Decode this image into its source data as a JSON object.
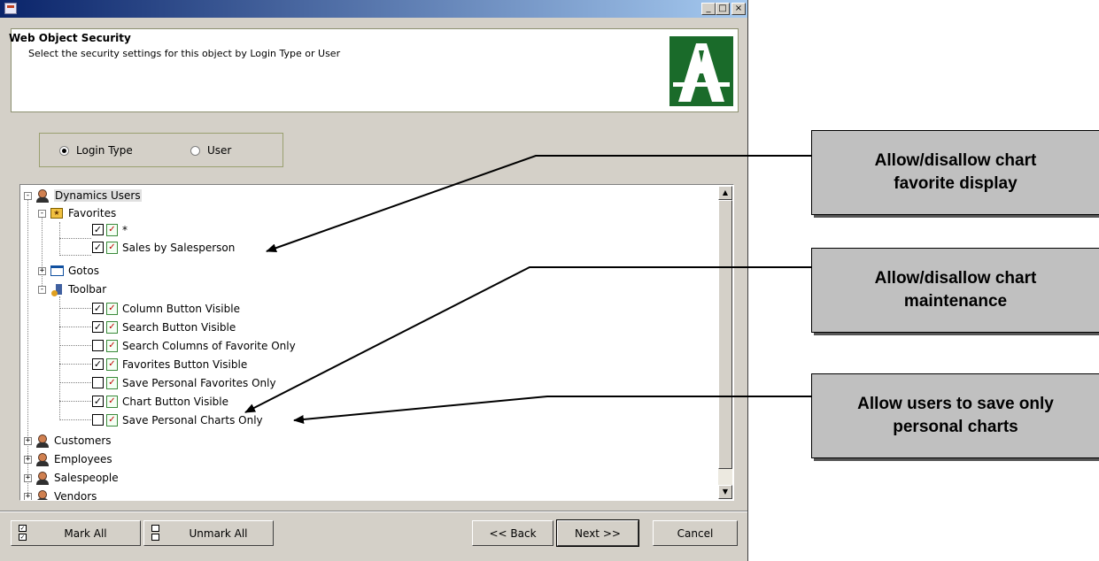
{
  "window": {
    "minimize": "_",
    "maximize": "□",
    "close": "×"
  },
  "header": {
    "title": "Web Object Security",
    "subtitle": "Select the security settings for this object by Login Type or User"
  },
  "radio": {
    "options": [
      {
        "label": "Login Type",
        "selected": true
      },
      {
        "label": "User",
        "selected": false
      }
    ]
  },
  "tree": {
    "root": "Dynamics Users",
    "favorites": {
      "label": "Favorites",
      "items": [
        {
          "label": "*",
          "checked": true
        },
        {
          "label": "Sales by Salesperson",
          "checked": true
        }
      ]
    },
    "gotos": "Gotos",
    "toolbar": {
      "label": "Toolbar",
      "items": [
        {
          "label": "Column Button Visible",
          "checked": true
        },
        {
          "label": "Search Button Visible",
          "checked": true
        },
        {
          "label": "Search Columns of Favorite Only",
          "checked": false
        },
        {
          "label": "Favorites Button Visible",
          "checked": true
        },
        {
          "label": "Save Personal Favorites Only",
          "checked": false
        },
        {
          "label": "Chart Button Visible",
          "checked": true
        },
        {
          "label": "Save Personal Charts Only",
          "checked": false
        }
      ]
    },
    "others": [
      "Customers",
      "Employees",
      "Salespeople",
      "Vendors"
    ]
  },
  "buttons": {
    "mark_all": "Mark All",
    "unmark_all": "Unmark All",
    "back": "<< Back",
    "next": "Next >>",
    "cancel": "Cancel"
  },
  "callouts": [
    "Allow/disallow chart favorite display",
    "Allow/disallow chart maintenance",
    "Allow users to save only personal charts"
  ]
}
